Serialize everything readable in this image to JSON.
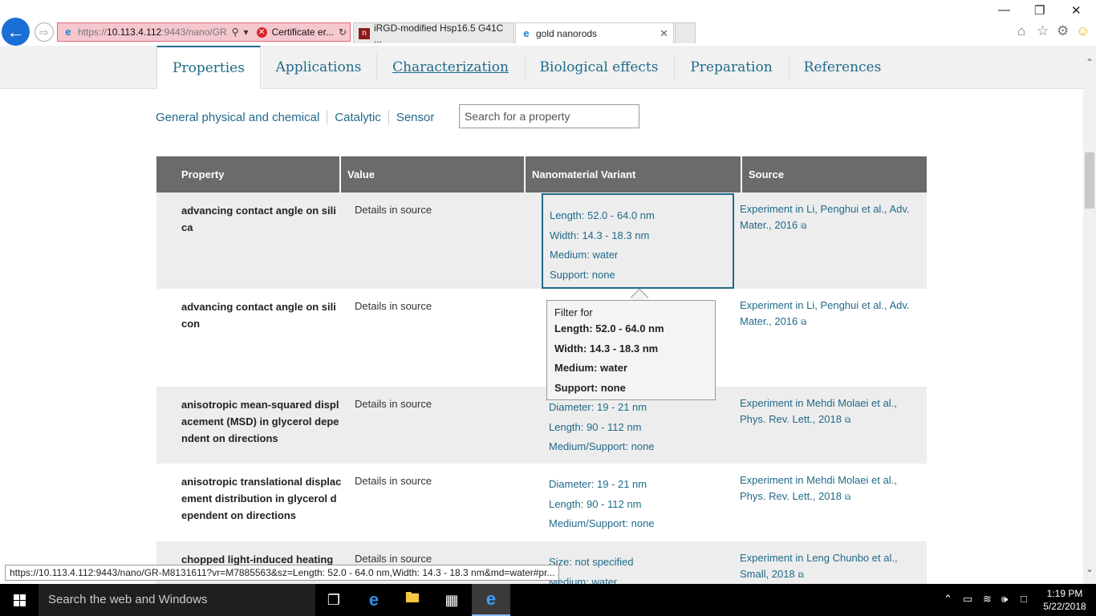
{
  "browser": {
    "address": {
      "url_prefix": "https://",
      "url_host": "10.113.4.112",
      "url_suffix": ":9443/nano/GR",
      "cert_text": "Certificate er..."
    },
    "tabs": [
      {
        "title": "iRGD-modified Hsp16.5 G41C ..."
      },
      {
        "title": "gold nanorods"
      }
    ]
  },
  "page_tabs": [
    "Properties",
    "Applications",
    "Characterization",
    "Biological effects",
    "Preparation",
    "References"
  ],
  "categories": [
    "General physical and chemical",
    "Catalytic",
    "Sensor"
  ],
  "search": {
    "placeholder": "Search for a property"
  },
  "table": {
    "headers": [
      "Property",
      "Value",
      "Nanomaterial Variant",
      "Source"
    ],
    "rows": [
      {
        "property": "advancing contact angle on silica",
        "value": "Details in source",
        "variant": [
          "Length: 52.0 - 64.0 nm",
          "Width: 14.3 - 18.3 nm",
          "Medium: water",
          "Support: none"
        ],
        "source": "Experiment in Li, Penghui et al., Adv. Mater., 2016"
      },
      {
        "property": "advancing contact angle on silicon",
        "value": "Details in source",
        "variant": [],
        "source": "Experiment in Li, Penghui et al., Adv. Mater., 2016"
      },
      {
        "property": "anisotropic mean-squared displacement (MSD) in glycerol dependent on directions",
        "value": "Details in source",
        "variant": [
          "Diameter: 19 - 21 nm",
          "Length: 90 - 112 nm",
          "Medium/Support: none"
        ],
        "source": "Experiment in Mehdi Molaei et al., Phys. Rev. Lett., 2018"
      },
      {
        "property": "anisotropic translational displacement distribution in glycerol dependent on directions",
        "value": "Details in source",
        "variant": [
          "Diameter: 19 - 21 nm",
          "Length: 90 - 112 nm",
          "Medium/Support: none"
        ],
        "source": "Experiment in Mehdi Molaei et al., Phys. Rev. Lett., 2018"
      },
      {
        "property": "chopped light-induced heating",
        "value": "Details in source",
        "variant": [
          "Size: not specified",
          "Medium: water"
        ],
        "source": "Experiment in Leng Chunbo et al., Small, 2018"
      }
    ]
  },
  "tooltip": {
    "title": "Filter for",
    "lines": [
      "Length: 52.0 - 64.0 nm",
      "Width: 14.3 - 18.3 nm",
      "Medium: water",
      "Support: none"
    ]
  },
  "status_url": "https://10.113.4.112:9443/nano/GR-M8131611?vr=M7885563&sz=Length: 52.0 - 64.0 nm,Width: 14.3 - 18.3 nm&md=water#pr...",
  "taskbar": {
    "search_placeholder": "Search the web and Windows",
    "time": "1:19 PM",
    "date": "5/22/2018"
  },
  "icons": [
    "back-icon",
    "forward-icon",
    "ie-icon",
    "search-icon",
    "certificate-error-icon",
    "refresh-icon",
    "home-icon",
    "star-icon",
    "gear-icon",
    "smiley-icon",
    "external-link-icon",
    "windows-icon",
    "task-view-icon",
    "edge-icon",
    "file-explorer-icon",
    "store-icon",
    "volume-icon",
    "wifi-icon",
    "notification-icon"
  ],
  "colors": {
    "accent": "#1f6a8a",
    "header_bg": "#6b6b6b",
    "row_shade": "#ededed",
    "address_error": "#f6c7cf"
  }
}
